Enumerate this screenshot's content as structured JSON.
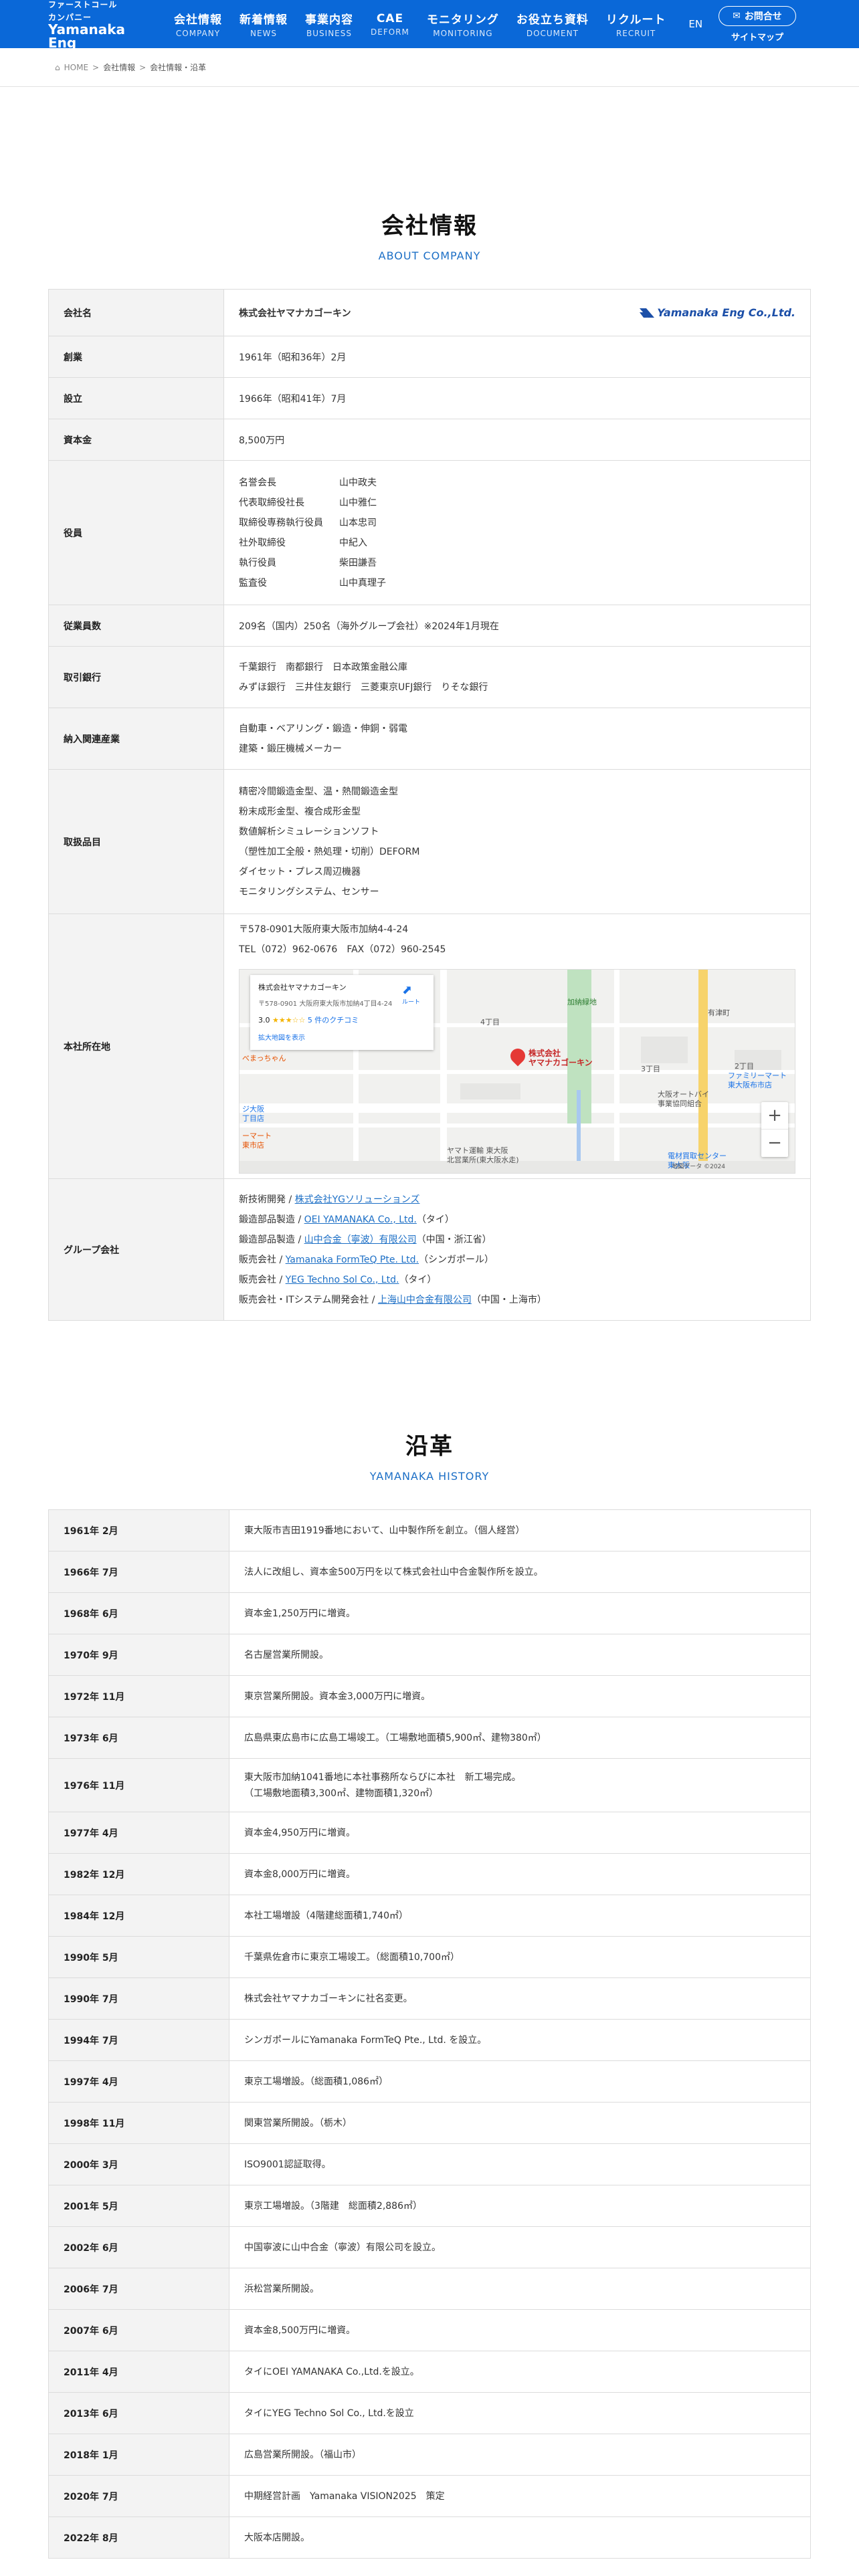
{
  "header": {
    "logo": {
      "line1": "ファーストコール",
      "line2": "カンパニー",
      "mark": "Yamanaka Eng"
    },
    "nav": [
      {
        "jp": "会社情報",
        "en": "COMPANY"
      },
      {
        "jp": "新着情報",
        "en": "NEWS"
      },
      {
        "jp": "事業内容",
        "en": "BUSINESS"
      },
      {
        "jp": "CAE",
        "en": "DEFORM"
      },
      {
        "jp": "モニタリング",
        "en": "MONITORING"
      },
      {
        "jp": "お役立ち資料",
        "en": "DOCUMENT"
      },
      {
        "jp": "リクルート",
        "en": "RECRUIT"
      }
    ],
    "lang": "EN",
    "contact": "お問合せ",
    "sitemap": "サイトマップ"
  },
  "breadcrumb": {
    "home": "HOME",
    "items": [
      "会社情報",
      "会社情報・沿革"
    ]
  },
  "company": {
    "title": "会社情報",
    "subtitle": "ABOUT COMPANY",
    "logo_text": "Yamanaka Eng Co.,Ltd.",
    "rows": {
      "name": {
        "label": "会社名",
        "value": "株式会社ヤマナカゴーキン"
      },
      "founded": {
        "label": "創業",
        "value": "1961年（昭和36年）2月"
      },
      "established": {
        "label": "設立",
        "value": "1966年（昭和41年）7月"
      },
      "capital": {
        "label": "資本金",
        "value": "8,500万円"
      },
      "officers": {
        "label": "役員",
        "items": [
          {
            "role": "名誉会長",
            "name": "山中政夫"
          },
          {
            "role": "代表取締役社長",
            "name": "山中雅仁"
          },
          {
            "role": "取締役専務執行役員",
            "name": "山本忠司"
          },
          {
            "role": "社外取締役",
            "name": "中紀入"
          },
          {
            "role": "執行役員",
            "name": "柴田謙吾"
          },
          {
            "role": "監査役",
            "name": "山中真理子"
          }
        ]
      },
      "employees": {
        "label": "従業員数",
        "value": "209名（国内）250名（海外グループ会社）※2024年1月現在"
      },
      "banks": {
        "label": "取引銀行",
        "lines": [
          "千葉銀行　南都銀行　日本政策金融公庫",
          "みずほ銀行　三井住友銀行　三菱東京UFJ銀行　りそな銀行"
        ]
      },
      "industries": {
        "label": "納入関連産業",
        "lines": [
          "自動車・ベアリング・鍛造・伸銅・弱電",
          "建築・鍛圧機械メーカー"
        ]
      },
      "products": {
        "label": "取扱品目",
        "lines": [
          "精密冷間鍛造金型、温・熱間鍛造金型",
          "粉末成形金型、複合成形金型",
          "数値解析シミュレーションソフト",
          "（塑性加工全般・熱処理・切削）DEFORM",
          "ダイセット・プレス周辺機器",
          "モニタリングシステム、センサー"
        ]
      },
      "hq": {
        "label": "本社所在地",
        "address": "〒578-0901大阪府東大阪市加納4-4-24",
        "tel": "TEL（072）962-0676　FAX（072）960-2545"
      },
      "group": {
        "label": "グループ会社",
        "items": [
          {
            "prefix": "新技術開発 / ",
            "link": "株式会社YGソリューションズ",
            "suffix": ""
          },
          {
            "prefix": "鍛造部品製造 / ",
            "link": "OEI YAMANAKA Co., Ltd.",
            "suffix": "（タイ）"
          },
          {
            "prefix": "鍛造部品製造 / ",
            "link": "山中合金（寧波）有限公司",
            "suffix": "（中国・浙江省）"
          },
          {
            "prefix": "販売会社 / ",
            "link": "Yamanaka FormTeQ Pte. Ltd.",
            "suffix": "（シンガポール）"
          },
          {
            "prefix": "販売会社 / ",
            "link": "YEG Techno Sol Co., Ltd.",
            "suffix": "（タイ）"
          },
          {
            "prefix": "販売会社・ITシステム開発会社 / ",
            "link": "上海山中合金有限公司",
            "suffix": "（中国・上海市）"
          }
        ]
      }
    },
    "map": {
      "card_title": "株式会社ヤマナカゴーキン",
      "card_addr": "〒578-0901 大阪府東大阪市加納4丁目4-24",
      "rating": "3.0",
      "stars": "★★★☆☆",
      "reviews": "5 件のクチコミ",
      "more": "拡大地図を表示",
      "directions": "ルート",
      "pin_label_1": "株式会社",
      "pin_label_2": "ヤマナカゴーキン",
      "labels": [
        "4丁目",
        "加納緑地",
        "有津町",
        "3丁目",
        "2丁目",
        "ファミリーマート",
        "東大阪布市店",
        "大阪オートバイ",
        "事業協同組合",
        "ヤマト運輸 東大阪",
        "北営業所(東大阪水走)",
        "べまっちゃん",
        "電材買取センター",
        "東大阪",
        "ジ大阪",
        "丁目店",
        "ーマート",
        "東市店"
      ],
      "attribution": "地図データ ©2024"
    }
  },
  "history": {
    "title": "沿革",
    "subtitle": "YAMANAKA HISTORY",
    "rows": [
      {
        "date": "1961年 2月",
        "lines": [
          "東大阪市吉田1919番地において、山中製作所を創立。（個人経営）"
        ]
      },
      {
        "date": "1966年 7月",
        "lines": [
          "法人に改組し、資本金500万円を以て株式会社山中合金製作所を設立。"
        ]
      },
      {
        "date": "1968年 6月",
        "lines": [
          "資本金1,250万円に増資。"
        ]
      },
      {
        "date": "1970年 9月",
        "lines": [
          "名古屋営業所開設。"
        ]
      },
      {
        "date": "1972年 11月",
        "lines": [
          "東京営業所開設。資本金3,000万円に増資。"
        ]
      },
      {
        "date": "1973年 6月",
        "lines": [
          "広島県東広島市に広島工場竣工。（工場敷地面積5,900㎡、建物380㎡）"
        ]
      },
      {
        "date": "1976年 11月",
        "lines": [
          "東大阪市加納1041番地に本社事務所ならびに本社　新工場完成。",
          "（工場敷地面積3,300㎡、建物面積1,320㎡）"
        ]
      },
      {
        "date": "1977年 4月",
        "lines": [
          "資本金4,950万円に増資。"
        ]
      },
      {
        "date": "1982年 12月",
        "lines": [
          "資本金8,000万円に増資。"
        ]
      },
      {
        "date": "1984年 12月",
        "lines": [
          "本社工場増設（4階建総面積1,740㎡）"
        ]
      },
      {
        "date": "1990年 5月",
        "lines": [
          "千葉県佐倉市に東京工場竣工。（総面積10,700㎡）"
        ]
      },
      {
        "date": "1990年 7月",
        "lines": [
          "株式会社ヤマナカゴーキンに社名変更。"
        ]
      },
      {
        "date": "1994年 7月",
        "lines": [
          "シンガポールにYamanaka FormTeQ Pte., Ltd. を設立。"
        ]
      },
      {
        "date": "1997年 4月",
        "lines": [
          "東京工場増設。（総面積1,086㎡）"
        ]
      },
      {
        "date": "1998年 11月",
        "lines": [
          "関東営業所開設。（栃木）"
        ]
      },
      {
        "date": "2000年 3月",
        "lines": [
          "ISO9001認証取得。"
        ]
      },
      {
        "date": "2001年 5月",
        "lines": [
          "東京工場増設。（3階建　総面積2,886㎡）"
        ]
      },
      {
        "date": "2002年 6月",
        "lines": [
          "中国寧波に山中合金（寧波）有限公司を設立。"
        ]
      },
      {
        "date": "2006年 7月",
        "lines": [
          "浜松営業所開設。"
        ]
      },
      {
        "date": "2007年 6月",
        "lines": [
          "資本金8,500万円に増資。"
        ]
      },
      {
        "date": "2011年 4月",
        "lines": [
          "タイにOEI YAMANAKA Co.,Ltd.を設立。"
        ]
      },
      {
        "date": "2013年 6月",
        "lines": [
          "タイにYEG Techno Sol Co., Ltd.を設立"
        ]
      },
      {
        "date": "2018年 1月",
        "lines": [
          "広島営業所開設。（福山市）"
        ]
      },
      {
        "date": "2020年 7月",
        "lines": [
          "中期経営計画　Yamanaka VISION2025　策定"
        ]
      },
      {
        "date": "2022年 8月",
        "lines": [
          "大阪本店開設。"
        ]
      }
    ]
  },
  "colors": {
    "header": "#0a68d8",
    "accent": "#1c6fc6",
    "label_bg": "#f3f3f3",
    "border": "#dcdcdc"
  }
}
